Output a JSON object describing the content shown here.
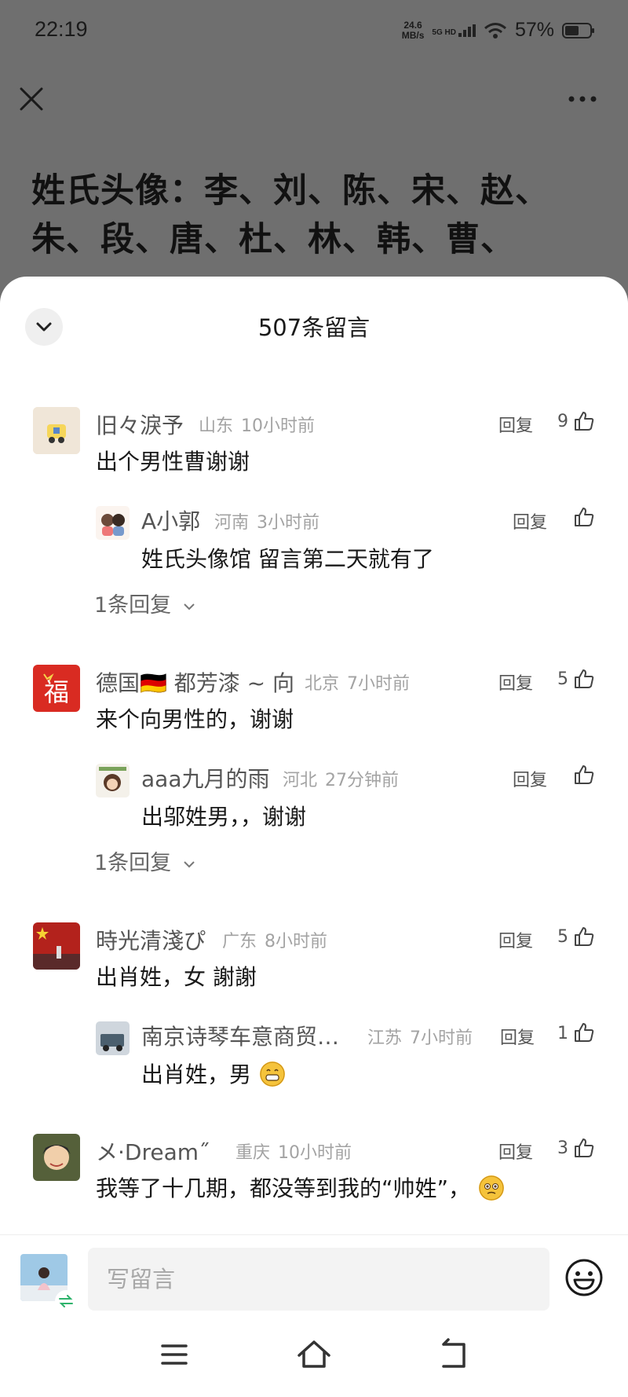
{
  "status_bar": {
    "time": "22:19",
    "net_speed_value": "24.6",
    "net_speed_unit": "MB/s",
    "signal": "5G HD",
    "battery": "57%",
    "battery_level": 0.57
  },
  "article": {
    "title": "姓氏头像：李、刘、陈、宋、赵、朱、段、唐、杜、林、韩、曹、"
  },
  "sheet": {
    "title": "507条留言"
  },
  "comments": [
    {
      "user": "旧々淚予",
      "location": "山东",
      "time": "10小时前",
      "reply_label": "回复",
      "likes": "9",
      "text": "出个男性曹谢谢",
      "reply": {
        "user": "A小郭",
        "location": "河南",
        "time": "3小时前",
        "reply_label": "回复",
        "likes": "",
        "text": "姓氏头像馆  留言第二天就有了"
      },
      "more_replies": "1条回复"
    },
    {
      "user": "德国🇩🇪 都芳漆 ~ 向",
      "location": "北京",
      "time": "7小时前",
      "reply_label": "回复",
      "likes": "5",
      "text": "来个向男性的，谢谢",
      "reply": {
        "user": "aaa九月的雨",
        "location": "河北",
        "time": "27分钟前",
        "reply_label": "回复",
        "likes": "",
        "text": "出邬姓男，，谢谢"
      },
      "more_replies": "1条回复"
    },
    {
      "user": "時光清淺ぴ",
      "location": "广东",
      "time": "8小时前",
      "reply_label": "回复",
      "likes": "5",
      "text": "出肖姓，女  謝謝",
      "reply": {
        "user": "南京诗琴车意商贸…",
        "location": "江苏",
        "time": "7小时前",
        "reply_label": "回复",
        "likes": "1",
        "text": "出肖姓，男"
      }
    },
    {
      "user": "メ·Dream˝",
      "location": "重庆",
      "time": "10小时前",
      "reply_label": "回复",
      "likes": "3",
      "text": "我等了十几期，都没等到我的“帅姓”，"
    }
  ],
  "input": {
    "placeholder": "写留言"
  },
  "icons": {
    "close": "close-icon",
    "more": "more-icon",
    "collapse": "chevron-down-icon",
    "like": "thumbs-up-icon",
    "emoji": "emoji-icon",
    "menu": "menu-icon",
    "home": "home-icon",
    "back": "back-icon"
  },
  "colors": {
    "overlay": "#6f6f6f",
    "sheet_bg": "#ffffff",
    "meta_text": "#a3a3a3",
    "username_text": "#555555"
  }
}
